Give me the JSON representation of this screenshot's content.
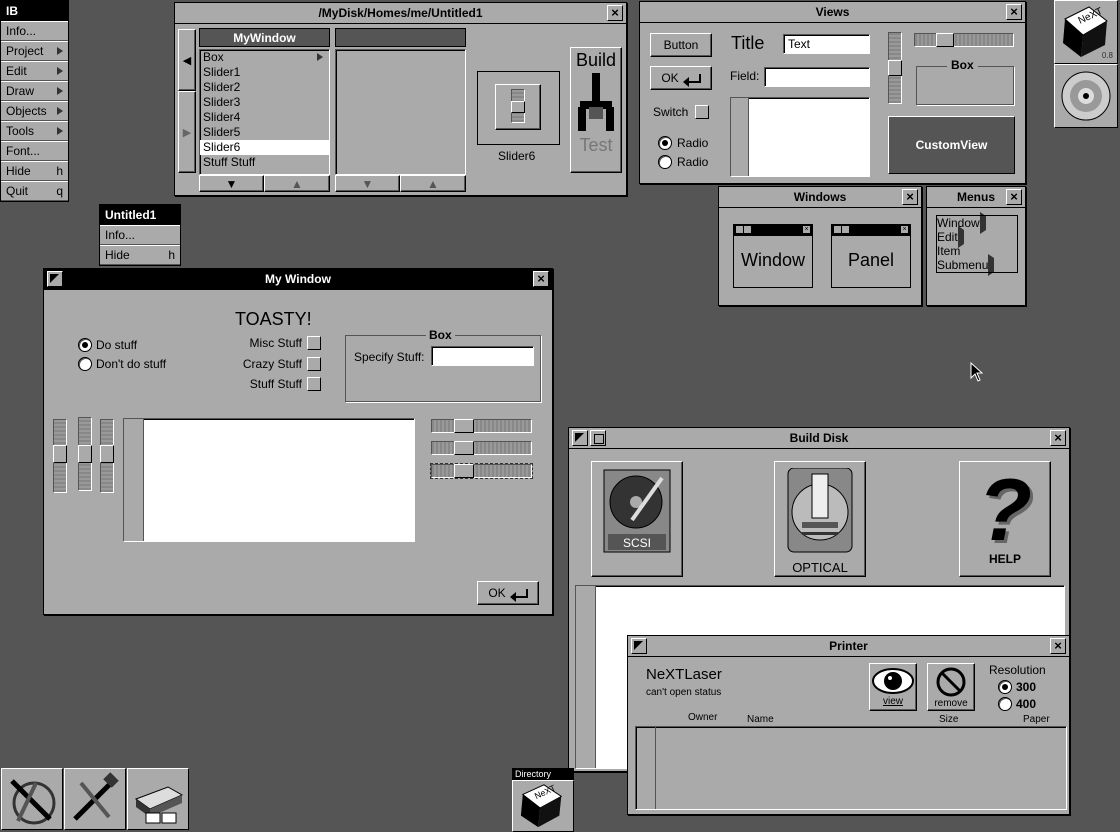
{
  "main_menu": {
    "title": "IB",
    "items": [
      {
        "label": "Info...",
        "key": "",
        "submenu": false
      },
      {
        "label": "Project",
        "key": "",
        "submenu": true
      },
      {
        "label": "Edit",
        "key": "",
        "submenu": true
      },
      {
        "label": "Draw",
        "key": "",
        "submenu": true
      },
      {
        "label": "Objects",
        "key": "",
        "submenu": true
      },
      {
        "label": "Tools",
        "key": "",
        "submenu": true
      },
      {
        "label": "Font...",
        "key": "",
        "submenu": false
      },
      {
        "label": "Hide",
        "key": "h",
        "submenu": false
      },
      {
        "label": "Quit",
        "key": "q",
        "submenu": false
      }
    ]
  },
  "untitled_menu": {
    "title": "Untitled1",
    "items": [
      {
        "label": "Info...",
        "key": ""
      },
      {
        "label": "Hide",
        "key": "h"
      }
    ]
  },
  "project_window": {
    "title": "/MyDisk/Homes/me/Untitled1",
    "col1_header": "MyWindow",
    "col2_header": "",
    "items": [
      "Box",
      "Slider1",
      "Slider2",
      "Slider3",
      "Slider4",
      "Slider5",
      "Slider6",
      "Stuff Stuff"
    ],
    "selected": "Slider6",
    "slider_label": "Slider6",
    "build_label": "Build",
    "test_label": "Test"
  },
  "views_window": {
    "title": "Views",
    "button_label": "Button",
    "ok_label": "OK",
    "title_label": "Title",
    "text_value": "Text",
    "field_label": "Field:",
    "switch_label": "Switch",
    "radio1_label": "Radio",
    "radio2_label": "Radio",
    "box_label": "Box",
    "custom_view_label": "CustomView"
  },
  "windows_palette": {
    "title": "Windows",
    "window_label": "Window",
    "panel_label": "Panel"
  },
  "menus_palette": {
    "title": "Menus",
    "items": [
      {
        "label": "Window",
        "submenu": true
      },
      {
        "label": "Edit",
        "submenu": true
      },
      {
        "label": "Item",
        "submenu": false
      },
      {
        "label": "Submenu",
        "submenu": true
      }
    ]
  },
  "my_window": {
    "title": "My Window",
    "heading": "TOASTY!",
    "radio_do": "Do stuff",
    "radio_dont": "Don't do stuff",
    "check1": "Misc Stuff",
    "check2": "Crazy Stuff",
    "check3": "Stuff Stuff",
    "box_title": "Box",
    "specify_label": "Specify Stuff:",
    "specify_value": "",
    "ok_label": "OK"
  },
  "build_disk": {
    "title": "Build Disk",
    "scsi_label": "SCSI",
    "optical_label": "OPTICAL",
    "help_label": "HELP"
  },
  "printer": {
    "title": "Printer",
    "printer_name": "NeXTLaser",
    "status": "can't open status",
    "view_label": "view",
    "remove_label": "remove",
    "resolution_label": "Resolution",
    "res_300": "300",
    "res_400": "400",
    "col_owner": "Owner",
    "col_name": "Name",
    "col_size": "Size",
    "col_paper": "Paper"
  },
  "dock": {
    "version": "0.8",
    "directory_label": "Directory"
  }
}
